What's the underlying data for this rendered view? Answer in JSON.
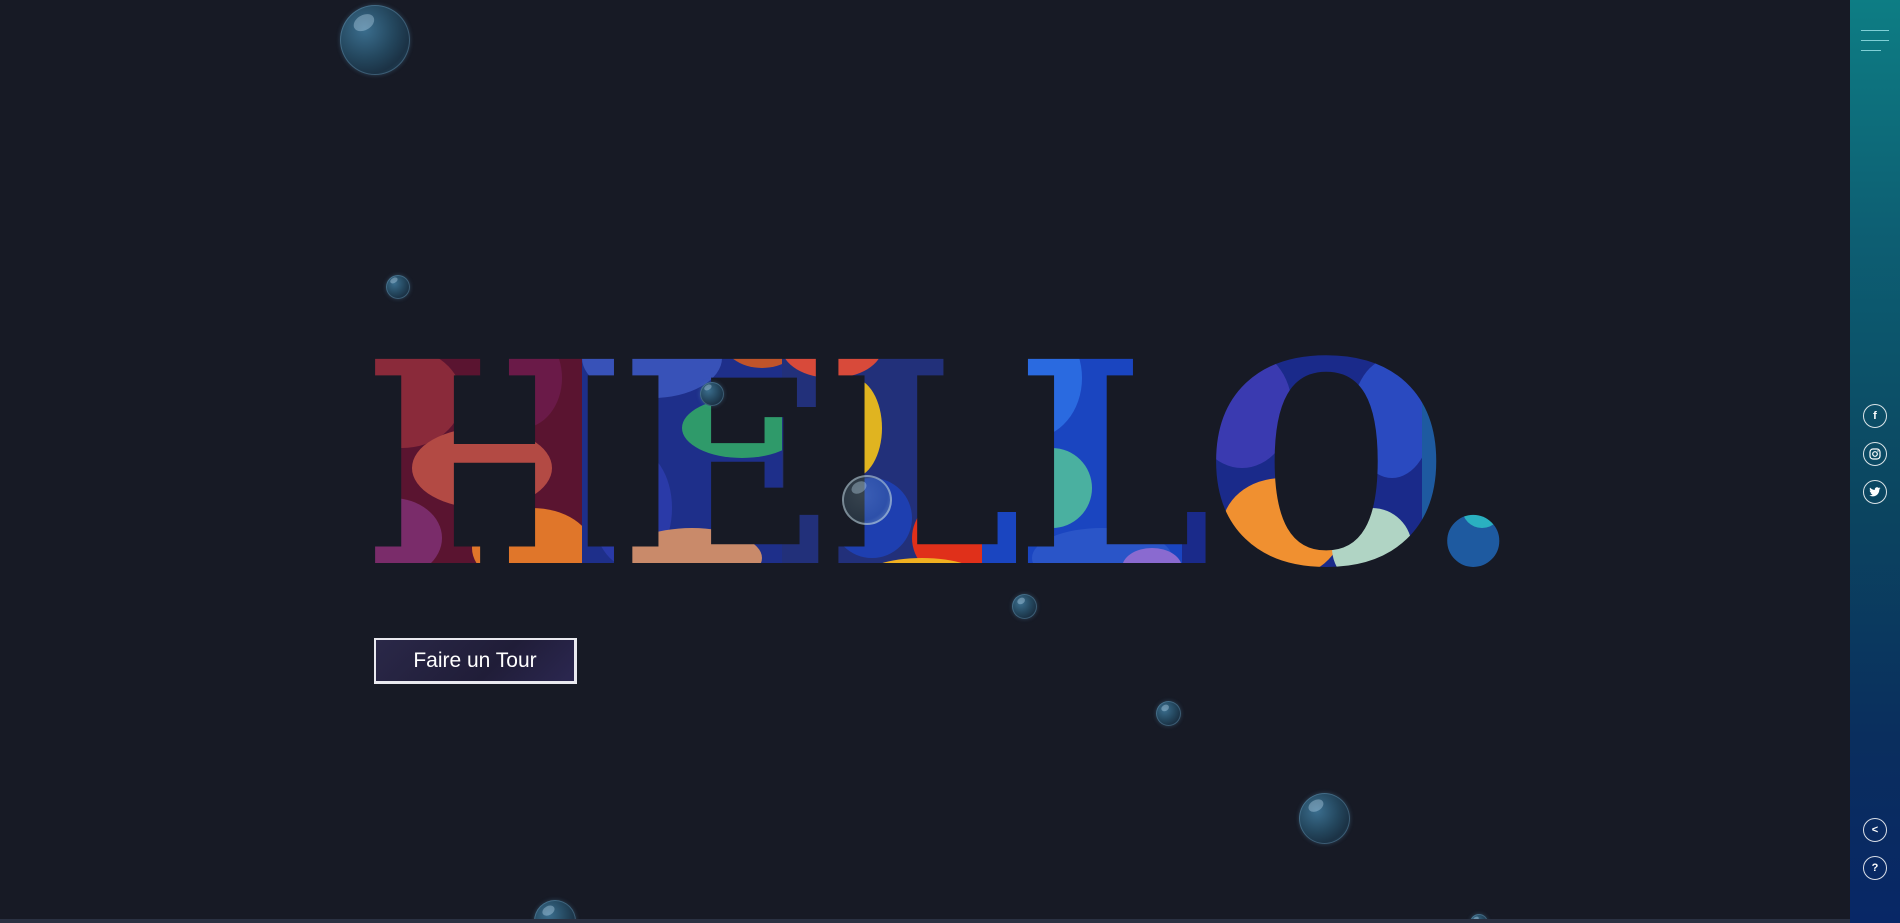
{
  "hero": {
    "title": "HELLO.",
    "cta_label": "Faire un Tour"
  },
  "right_rail": {
    "menu_icon": "hamburger-menu-icon",
    "social": [
      {
        "name": "facebook-icon",
        "glyph": "f"
      },
      {
        "name": "instagram-icon",
        "glyph": "◎"
      },
      {
        "name": "twitter-icon",
        "glyph": "🐦"
      }
    ],
    "share_glyph": "<",
    "help_glyph": "?"
  },
  "colors": {
    "background": "#171a25",
    "rail_top": "#0d7d84",
    "rail_bottom": "#082766",
    "button_border": "#e9e9ef",
    "bubble": "#2a5470"
  }
}
